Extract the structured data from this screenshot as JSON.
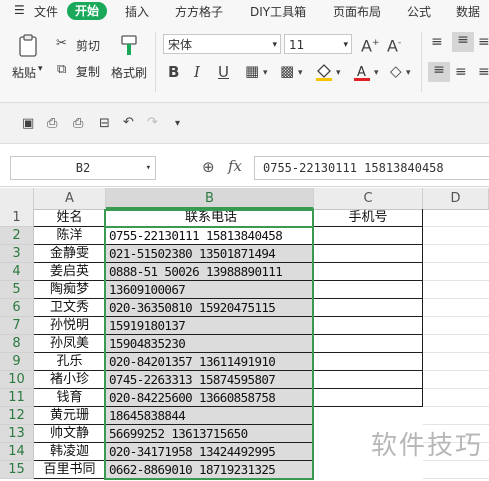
{
  "menu": {
    "file": "文件",
    "items": [
      "开始",
      "插入",
      "方方格子",
      "DIY工具箱",
      "页面布局",
      "公式",
      "数据"
    ]
  },
  "ribbon": {
    "paste": "粘贴",
    "cut": "剪切",
    "copy": "复制",
    "format_painter": "格式刷",
    "font_name": "宋体",
    "font_size": "11",
    "bold": "B",
    "italic": "I",
    "underline": "U",
    "grow_font": "A",
    "shrink_font": "A"
  },
  "formula_bar": {
    "name_box": "B2",
    "fx": "fx",
    "formula": "0755-22130111 15813840458"
  },
  "grid": {
    "columns": [
      "A",
      "B",
      "C",
      "D"
    ],
    "header_row": {
      "a": "姓名",
      "b": "联系电话",
      "c": "手机号"
    },
    "rows": [
      {
        "num": "1"
      },
      {
        "num": "2",
        "a": "陈洋",
        "b": "0755-22130111 15813840458"
      },
      {
        "num": "3",
        "a": "金静雯",
        "b": "021-51502380 13501871494"
      },
      {
        "num": "4",
        "a": "姜启英",
        "b": "0888-51 50026 13988890111"
      },
      {
        "num": "5",
        "a": "陶痴梦",
        "b": "13609100067"
      },
      {
        "num": "6",
        "a": "卫文秀",
        "b": "020-36350810 15920475115"
      },
      {
        "num": "7",
        "a": "孙悦明",
        "b": "15919180137"
      },
      {
        "num": "8",
        "a": "孙凤美",
        "b": "15904835230"
      },
      {
        "num": "9",
        "a": "孔乐",
        "b": "020-84201357 13611491910"
      },
      {
        "num": "10",
        "a": "褚小珍",
        "b": "0745-2263313 15874595807"
      },
      {
        "num": "11",
        "a": "钱育",
        "b": "020-84225600 13660858758"
      },
      {
        "num": "12",
        "a": "黄元珊",
        "b": "18645838844"
      },
      {
        "num": "13",
        "a": "帅文静",
        "b": "56699252 13613715650"
      },
      {
        "num": "14",
        "a": "韩凌迦",
        "b": "020-34171958 13424492995"
      },
      {
        "num": "15",
        "a": "百里书同",
        "b": "0662-8869010 18719231325"
      }
    ]
  },
  "watermark": "软件技巧",
  "colors": {
    "accent": "#1aa85a",
    "selection": "#3a9a4f",
    "selected_fill": "#dcdcdc"
  }
}
